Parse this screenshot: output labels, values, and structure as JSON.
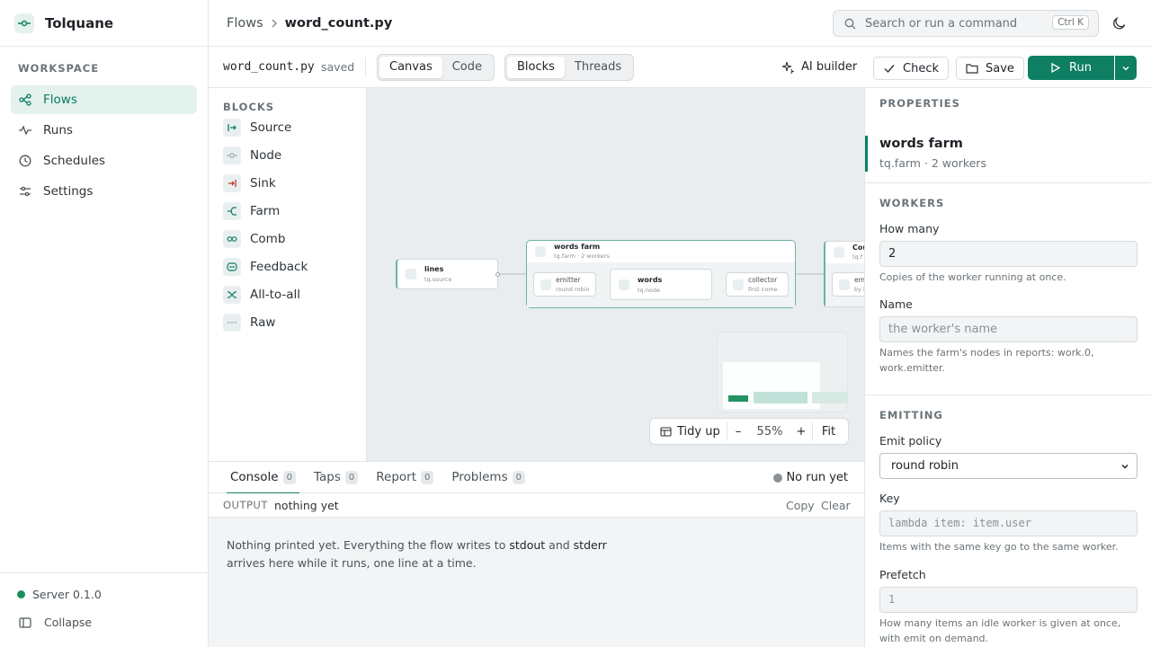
{
  "app": {
    "name": "Tolquane"
  },
  "sidebar": {
    "section": "WORKSPACE",
    "items": [
      {
        "label": "Flows",
        "icon": "flows-icon",
        "active": true
      },
      {
        "label": "Runs",
        "icon": "pulse-icon"
      },
      {
        "label": "Schedules",
        "icon": "clock-icon"
      },
      {
        "label": "Settings",
        "icon": "sliders-icon"
      }
    ],
    "server": "Server 0.1.0",
    "collapse": "Collapse"
  },
  "header": {
    "crumb_root": "Flows",
    "crumb_current": "word_count.py",
    "search_placeholder": "Search or run a command",
    "search_shortcut": "Ctrl K"
  },
  "toolbar": {
    "filename": "word_count.py",
    "status": "saved",
    "view_options": [
      "Canvas",
      "Code"
    ],
    "view_active": "Canvas",
    "mode_options": [
      "Blocks",
      "Threads"
    ],
    "mode_active": "Blocks",
    "ai_builder": "AI builder",
    "check": "Check",
    "save": "Save",
    "run": "Run"
  },
  "blocks": {
    "title": "BLOCKS",
    "items": [
      {
        "label": "Source",
        "icon": "source-icon"
      },
      {
        "label": "Node",
        "icon": "node-icon"
      },
      {
        "label": "Sink",
        "icon": "sink-icon"
      },
      {
        "label": "Farm",
        "icon": "farm-icon"
      },
      {
        "label": "Comb",
        "icon": "comb-icon"
      },
      {
        "label": "Feedback",
        "icon": "feedback-icon"
      },
      {
        "label": "All-to-all",
        "icon": "all-to-all-icon"
      },
      {
        "label": "Raw",
        "icon": "raw-icon"
      }
    ]
  },
  "canvas": {
    "nodes": {
      "lines": {
        "title": "lines",
        "sub": "tq.source"
      },
      "farm": {
        "title": "words farm",
        "sub": "tq.farm · 2 workers"
      },
      "emitter": {
        "title": "emitter",
        "sub": "round robin"
      },
      "words": {
        "title": "words",
        "sub": "tq.node"
      },
      "collector": {
        "title": "collector",
        "sub": "first come"
      },
      "partial": {
        "title": "Cou",
        "sub": "tq.f",
        "inner_title": "emi",
        "inner_sub": "by k"
      }
    },
    "zoom": {
      "tidy": "Tidy up",
      "minus": "–",
      "level": "55%",
      "plus": "+",
      "fit": "Fit"
    }
  },
  "console": {
    "tabs": [
      {
        "label": "Console",
        "count": "0"
      },
      {
        "label": "Taps",
        "count": "0"
      },
      {
        "label": "Report",
        "count": "0"
      },
      {
        "label": "Problems",
        "count": "0"
      }
    ],
    "run_status": "No run yet",
    "output_label": "OUTPUT",
    "output_value": "nothing yet",
    "copy": "Copy",
    "clear": "Clear",
    "empty_1": "Nothing printed yet. Everything the flow writes to",
    "empty_stdout": "stdout",
    "empty_and": "and",
    "empty_stderr": "stderr",
    "empty_2": "arrives here while it runs, one line at a time."
  },
  "properties": {
    "title": "PROPERTIES",
    "selected_name": "words farm",
    "selected_sub": "tq.farm · 2 workers",
    "workers_title": "WORKERS",
    "how_many_label": "How many",
    "how_many_value": "2",
    "how_many_hint": "Copies of the worker running at once.",
    "name_label": "Name",
    "name_placeholder": "the worker's name",
    "name_hint": "Names the farm's nodes in reports: work.0, work.emitter.",
    "emitting_title": "EMITTING",
    "policy_label": "Emit policy",
    "policy_value": "round robin",
    "key_label": "Key",
    "key_placeholder": "lambda item: item.user",
    "key_hint": "Items with the same key go to the same worker.",
    "prefetch_label": "Prefetch",
    "prefetch_placeholder": "1",
    "prefetch_hint": "How many items an idle worker is given at once, with emit on demand."
  },
  "colors": {
    "accent": "#0f7f63",
    "accent_soft": "#e4f2ee",
    "sink": "#c0392b"
  }
}
